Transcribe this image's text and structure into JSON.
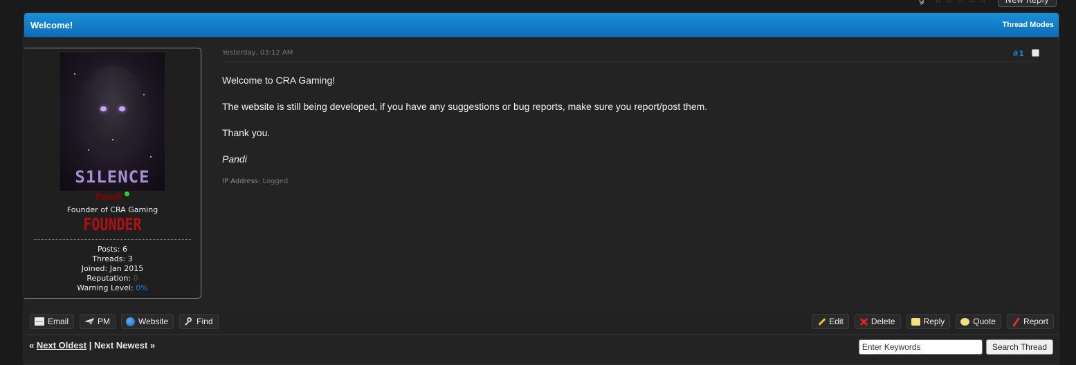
{
  "top": {
    "rating_label": "g",
    "stars": [
      "☆",
      "☆",
      "☆",
      "☆",
      "☆"
    ],
    "new_reply_label": "New Reply"
  },
  "thread": {
    "title": "Welcome!",
    "modes_label": "Thread Modes"
  },
  "author": {
    "avatar_text": "S1LENCE",
    "username": "Pandi",
    "usertitle": "Founder of CRA Gaming",
    "rank": "FOUNDER",
    "stats": {
      "posts_label": "Posts:",
      "posts": "6",
      "threads_label": "Threads:",
      "threads": "3",
      "joined_label": "Joined:",
      "joined": "Jan 2015",
      "reputation_label": "Reputation:",
      "reputation": "0",
      "warning_label": "Warning Level:",
      "warning": "0%"
    },
    "status_color": "#2ecc40"
  },
  "post": {
    "date": "Yesterday, 03:12 AM",
    "number": "#1",
    "paragraphs": [
      "Welcome to CRA Gaming!",
      "The website is still being developed, if you have any suggestions or bug reports, make sure you report/post them.",
      "Thank you."
    ],
    "signature": "Pandi",
    "ip_label": "IP Address:",
    "ip_value": "Logged"
  },
  "controls": {
    "left": [
      {
        "label": "Email",
        "icon": "mail-icon"
      },
      {
        "label": "PM",
        "icon": "send-icon"
      },
      {
        "label": "Website",
        "icon": "globe-icon"
      },
      {
        "label": "Find",
        "icon": "magnifier-icon"
      }
    ],
    "right": [
      {
        "label": "Edit",
        "icon": "pencil-icon"
      },
      {
        "label": "Delete",
        "icon": "delete-icon"
      },
      {
        "label": "Reply",
        "icon": "reply-icon"
      },
      {
        "label": "Quote",
        "icon": "quote-icon"
      },
      {
        "label": "Report",
        "icon": "report-icon"
      }
    ]
  },
  "pager": {
    "prev_prefix": "«",
    "prev_label": "Next Oldest",
    "sep": "|",
    "next_label": "Next Newest",
    "next_suffix": "»"
  },
  "search": {
    "placeholder": "Enter Keywords",
    "button_label": "Search Thread"
  },
  "colors": {
    "header_blue": "#0d6db6",
    "link_blue": "#1e7fd4",
    "rank_red": "#b01010"
  }
}
